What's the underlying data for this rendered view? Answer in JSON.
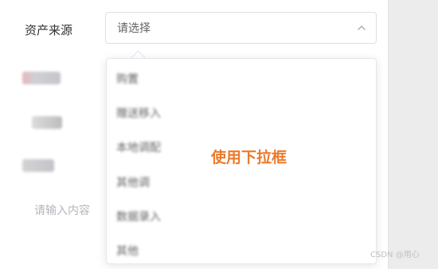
{
  "form": {
    "field_label": "资产来源",
    "select_placeholder": "请选择",
    "hint_placeholder": "请输入内容"
  },
  "dropdown": {
    "options": [
      "购置",
      "赠送移入",
      "本地调配",
      "其他调",
      "数据录入",
      "其他"
    ]
  },
  "annotation": "使用下拉框",
  "watermark": "CSDN @用心"
}
